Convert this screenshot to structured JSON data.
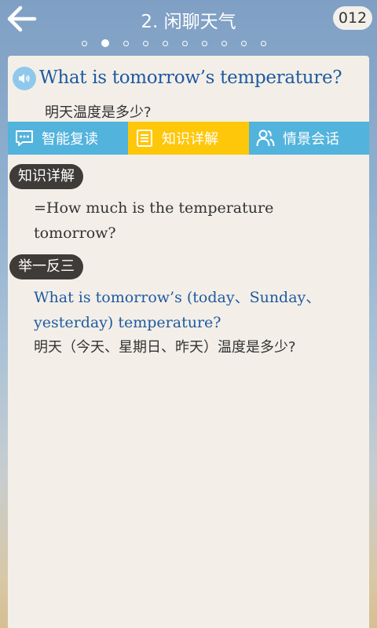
{
  "header": {
    "title": "2. 闲聊天气",
    "counter": "012",
    "page_dots": {
      "total": 10,
      "active_index": 1
    }
  },
  "sentence": {
    "english": "What is tomorrow’s temperature?",
    "chinese": "明天温度是多少?"
  },
  "tabs": [
    {
      "label": "智能复读",
      "icon": "chat-bubble-icon",
      "active": false
    },
    {
      "label": "知识详解",
      "icon": "document-icon",
      "active": true
    },
    {
      "label": "情景会话",
      "icon": "people-icon",
      "active": false
    }
  ],
  "knowledge": {
    "heading": "知识详解",
    "text": "=How much is the temperature tomorrow?"
  },
  "example": {
    "heading": "举一反三",
    "english": "What is tomorrow’s (today、Sunday、yesterday) temperature?",
    "chinese": "明天（今天、星期日、昨天）温度是多少?"
  },
  "colors": {
    "tab_blue": "#52b3dc",
    "tab_yellow": "#ffc70a",
    "english_text": "#1f5aa0"
  }
}
